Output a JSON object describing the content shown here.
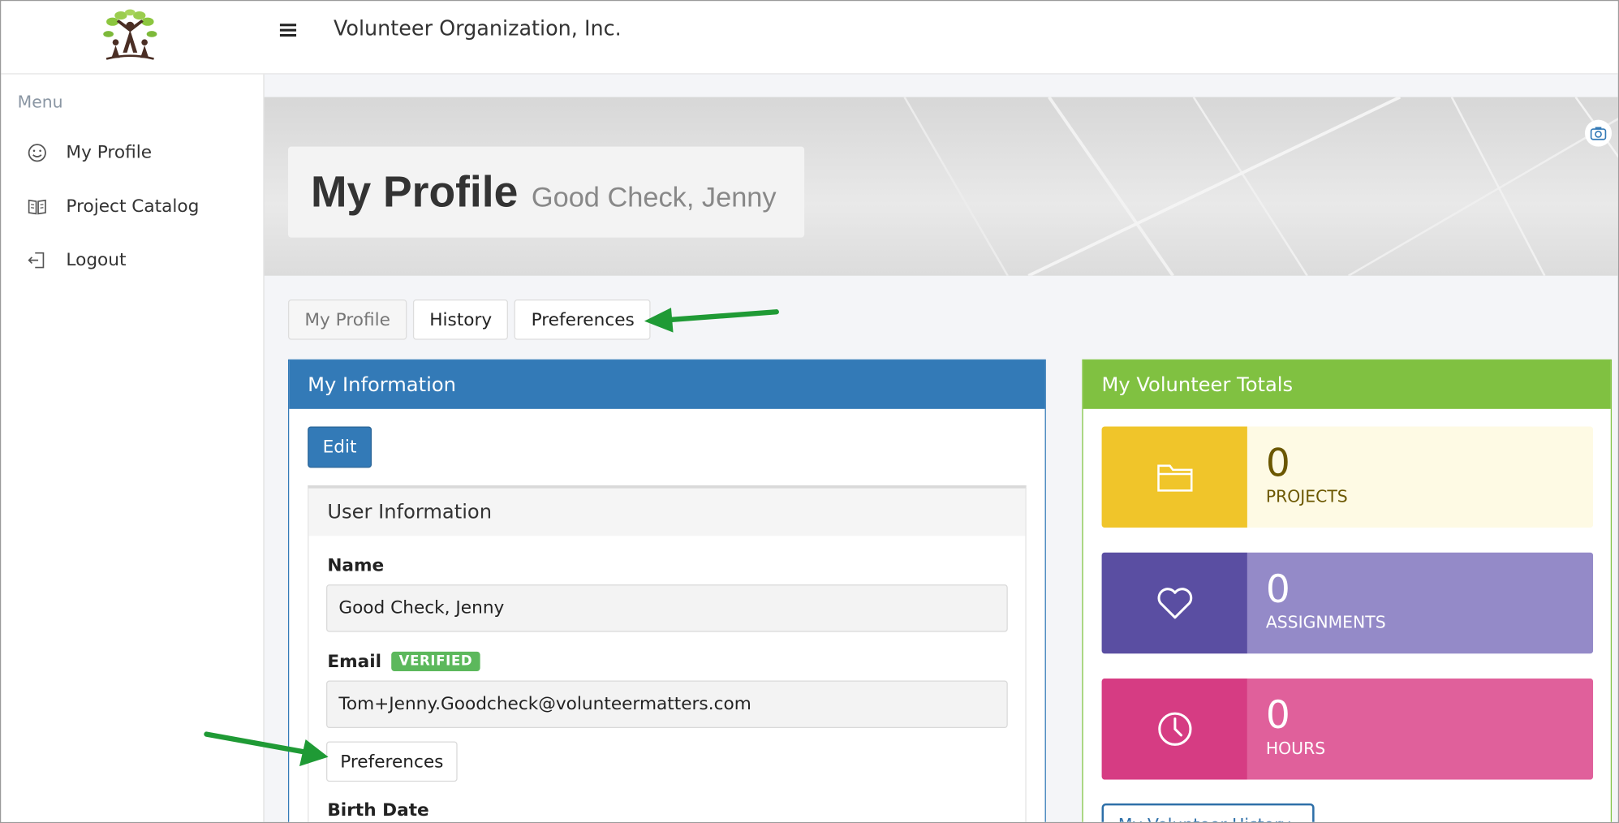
{
  "header": {
    "app_title": "Volunteer Organization, Inc.",
    "menu_icon": "hamburger-icon",
    "logo_icon": "tree-people-logo"
  },
  "sidebar": {
    "menu_label": "Menu",
    "items": [
      {
        "label": "My Profile",
        "icon": "smiley-icon"
      },
      {
        "label": "Project Catalog",
        "icon": "book-icon"
      },
      {
        "label": "Logout",
        "icon": "logout-icon"
      }
    ]
  },
  "hero": {
    "title": "My Profile",
    "subtitle": "Good Check, Jenny",
    "camera_icon": "camera-icon"
  },
  "tabs": [
    {
      "label": "My Profile",
      "active": true
    },
    {
      "label": "History",
      "active": false
    },
    {
      "label": "Preferences",
      "active": false
    }
  ],
  "my_information": {
    "heading": "My Information",
    "edit_label": "Edit",
    "user_info_heading": "User Information",
    "name_label": "Name",
    "name_value": "Good Check, Jenny",
    "email_label": "Email",
    "verified_badge": "VERIFIED",
    "email_value": "Tom+Jenny.Goodcheck@volunteermatters.com",
    "preferences_button": "Preferences",
    "birth_date_label": "Birth Date"
  },
  "volunteer_totals": {
    "heading": "My Volunteer Totals",
    "stats": [
      {
        "value": "0",
        "caption": "PROJECTS",
        "icon": "folder-icon"
      },
      {
        "value": "0",
        "caption": "ASSIGNMENTS",
        "icon": "heart-icon"
      },
      {
        "value": "0",
        "caption": "HOURS",
        "icon": "clock-icon"
      }
    ],
    "history_button": "My Volunteer History"
  },
  "colors": {
    "primary_blue": "#337ab7",
    "green": "#80c141",
    "annotation_arrow": "#1f9a35",
    "projects": "#f0c52a",
    "assignments": "#5a4ea2",
    "hours": "#d63c83",
    "verified": "#5cb85c"
  }
}
